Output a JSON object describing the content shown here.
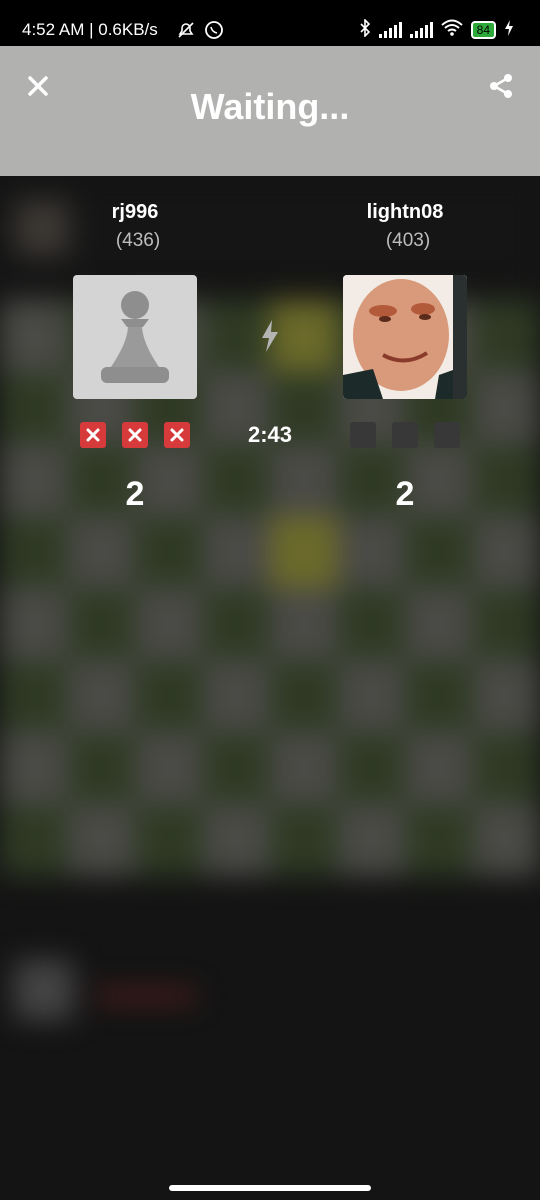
{
  "status_bar": {
    "time_speed": "4:52 AM | 0.6KB/s",
    "battery": "84",
    "icons": [
      "alarm-off-icon",
      "whatsapp-icon",
      "bluetooth-icon",
      "signal-icon",
      "wifi-icon",
      "battery-icon",
      "charging-icon"
    ]
  },
  "header": {
    "title": "Waiting...",
    "close_icon": "close-icon",
    "share_icon": "share-icon",
    "background": "#b1b1b0"
  },
  "players": {
    "left": {
      "name": "rj996",
      "rating": "(436)",
      "score": "2",
      "avatar": "pawn-icon"
    },
    "right": {
      "name": "lightn08",
      "rating": "(403)",
      "score": "2",
      "avatar": "profile-photo"
    }
  },
  "match": {
    "mode_icon": "lightning-bolt-icon",
    "clock": "2:43"
  },
  "colors": {
    "loss_mark": "#d63a3a",
    "empty_mark": "#383838"
  }
}
